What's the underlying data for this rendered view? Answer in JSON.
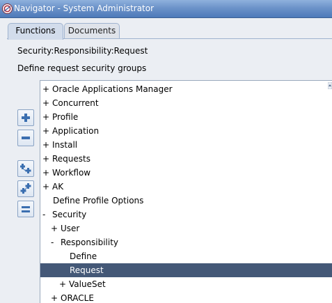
{
  "window": {
    "title": "Navigator - System Administrator"
  },
  "tabs": [
    {
      "label": "Functions",
      "active": true
    },
    {
      "label": "Documents",
      "active": false
    }
  ],
  "path": "Security:Responsibility:Request",
  "description": "Define request security groups",
  "tree": [
    {
      "toggle": "+",
      "label": "Oracle Applications Manager",
      "level": 0
    },
    {
      "toggle": "+",
      "label": "Concurrent",
      "level": 0
    },
    {
      "toggle": "+",
      "label": "Profile",
      "level": 0
    },
    {
      "toggle": "+",
      "label": "Application",
      "level": 0
    },
    {
      "toggle": "+",
      "label": "Install",
      "level": 0
    },
    {
      "toggle": "+",
      "label": "Requests",
      "level": 0
    },
    {
      "toggle": "+",
      "label": "Workflow",
      "level": 0
    },
    {
      "toggle": "+",
      "label": "AK",
      "level": 0
    },
    {
      "toggle": "",
      "label": "Define Profile Options",
      "level": 0
    },
    {
      "toggle": "-",
      "label": "Security",
      "level": 0
    },
    {
      "toggle": "+",
      "label": "User",
      "level": 1
    },
    {
      "toggle": "-",
      "label": "Responsibility",
      "level": 1
    },
    {
      "toggle": "",
      "label": "Define",
      "level": 2
    },
    {
      "toggle": "",
      "label": "Request",
      "level": 2,
      "selected": true
    },
    {
      "toggle": "+",
      "label": "ValueSet",
      "level": 2
    },
    {
      "toggle": "+",
      "label": "ORACLE",
      "level": 1
    }
  ],
  "colors": {
    "selection": "#445877",
    "titlebar": "#6c93c9"
  }
}
